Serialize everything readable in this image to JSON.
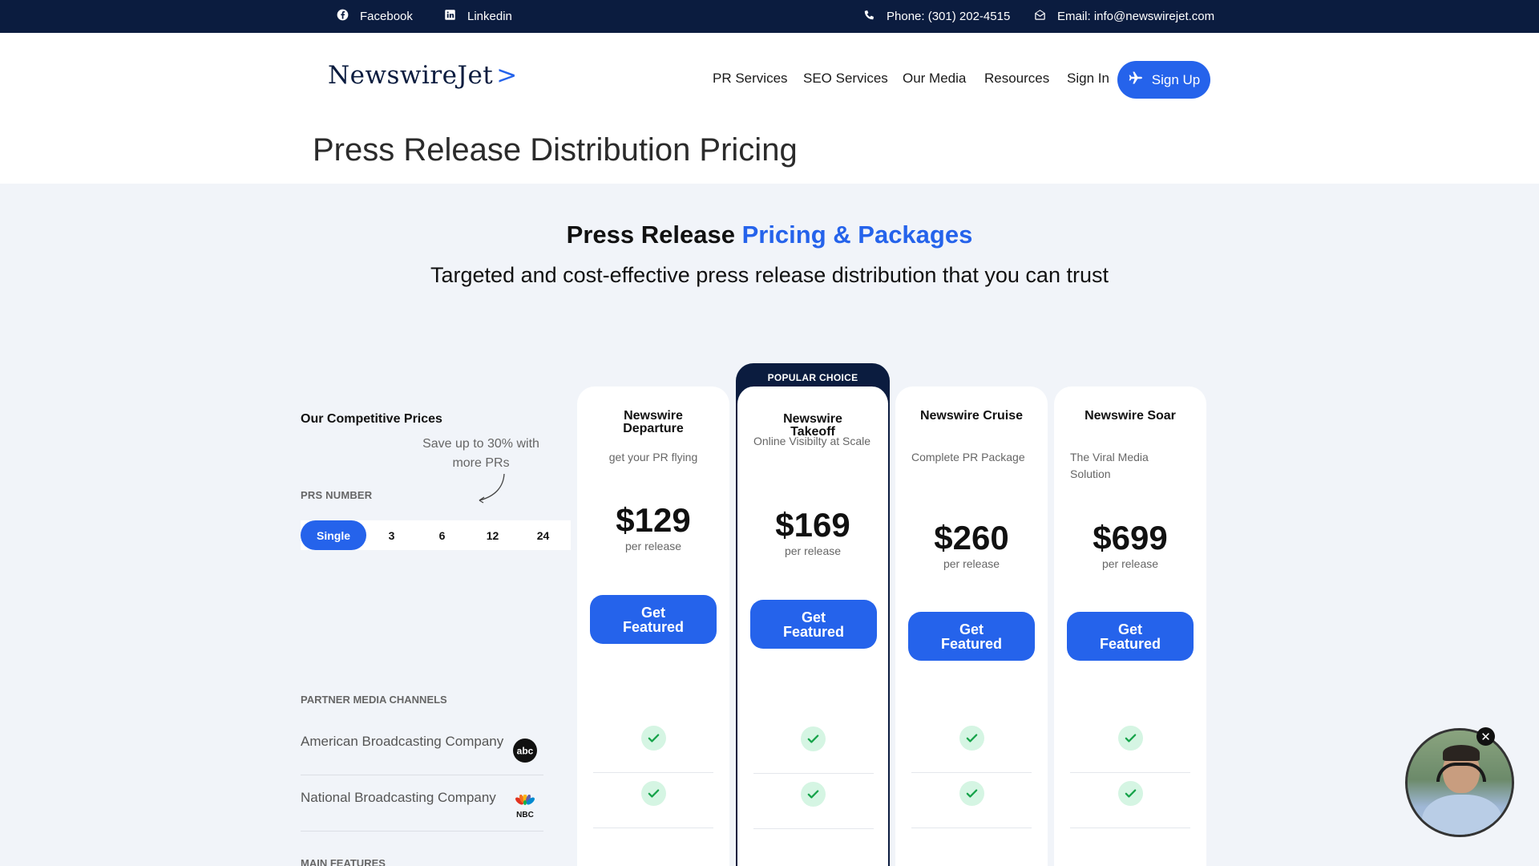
{
  "topbar": {
    "facebook": "Facebook",
    "linkedin": "Linkedin",
    "phone": "Phone: (301) 202-4515",
    "email": "Email: info@newswirejet.com"
  },
  "header": {
    "logo_text": "NewswireJet",
    "logo_arrow": ">",
    "nav": [
      "PR Services",
      "SEO Services",
      "Our Media",
      "Resources",
      "Sign In"
    ],
    "signup_label": "Sign Up"
  },
  "page_title": "Press Release Distribution Pricing",
  "pricing": {
    "title_plain": "Press Release ",
    "title_highlight": "Pricing & Packages",
    "subtitle": "Targeted and cost-effective press release distribution that you can trust",
    "our_prices": "Our Competitive Prices",
    "save_note": "Save up to 30% with more PRs",
    "prs_label": "PRS NUMBER",
    "prs_options": [
      "Single",
      "3",
      "6",
      "12",
      "24"
    ],
    "prs_selected": "Single",
    "partner_label": "PARTNER MEDIA CHANNELS",
    "partners": [
      "American Broadcasting Company",
      "National Broadcasting Company"
    ],
    "main_features_label": "MAIN FEATURES",
    "popular_label": "POPULAR CHOICE",
    "cta_label": "Get Featured",
    "per_label": "per release",
    "plans": [
      {
        "name": "Newswire Departure",
        "desc": "get your PR flying",
        "price": "$129"
      },
      {
        "name": "Newswire Takeoff",
        "desc": "Online Visibilty at Scale",
        "price": "$169"
      },
      {
        "name": "Newswire Cruise",
        "desc": "Complete PR Package",
        "price": "$260"
      },
      {
        "name": "Newswire Soar",
        "desc": "The Viral Media Solution",
        "price": "$699"
      }
    ]
  },
  "colors": {
    "navy": "#0b1c3f",
    "accent": "#2563eb",
    "check_bg": "#d5f5e3",
    "check": "#16a34a",
    "section_bg": "#f1f4f9"
  },
  "icons": [
    "facebook-icon",
    "linkedin-icon",
    "phone-icon",
    "email-icon",
    "plane-icon",
    "check-icon",
    "abc-logo",
    "nbc-logo",
    "close-icon"
  ]
}
